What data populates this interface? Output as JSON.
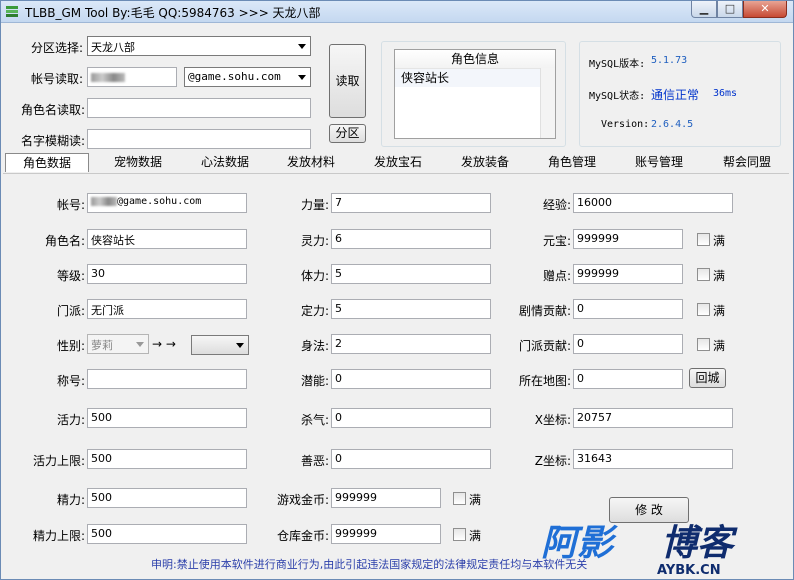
{
  "window": {
    "title": "TLBB_GM Tool By:毛毛 QQ:5984763 >>> 天龙八部"
  },
  "top": {
    "server_label": "分区选择:",
    "server_value": "天龙八部",
    "account_label": "帐号读取:",
    "account_domain": "@game.sohu.com",
    "role_read_label": "角色名读取:",
    "fuzzy_label": "名字模糊读:",
    "read_button": "读取",
    "partition_button": "分区"
  },
  "role_info": {
    "header": "角色信息",
    "items": [
      "侠容站长"
    ]
  },
  "mysql": {
    "version_label": "MySQL版本:",
    "version_value": "5.1.73",
    "status_label": "MySQL状态:",
    "status_value": "通信正常",
    "latency": "36ms",
    "tool_version_label": "Version:",
    "tool_version_value": "2.6.4.5"
  },
  "tabs": [
    "角色数据",
    "宠物数据",
    "心法数据",
    "发放材料",
    "发放宝石",
    "发放装备",
    "角色管理",
    "账号管理",
    "帮会同盟"
  ],
  "form": {
    "account_label": "帐号:",
    "account_suffix": "@game.sohu.com",
    "role_name_label": "角色名:",
    "role_name": "侠容站长",
    "level_label": "等级:",
    "level": "30",
    "sect_label": "门派:",
    "sect": "无门派",
    "gender_label": "性别:",
    "gender": "萝莉",
    "arrow": "→ →",
    "title_label": "称号:",
    "title": "",
    "vitality_label": "活力:",
    "vitality": "500",
    "vitality_max_label": "活力上限:",
    "vitality_max": "500",
    "energy_label": "精力:",
    "energy": "500",
    "energy_max_label": "精力上限:",
    "energy_max": "500",
    "str_label": "力量:",
    "str": "7",
    "spirit_label": "灵力:",
    "spirit": "6",
    "con_label": "体力:",
    "con": "5",
    "focus_label": "定力:",
    "focus": "5",
    "agi_label": "身法:",
    "agi": "2",
    "potential_label": "潜能:",
    "potential": "0",
    "killing_label": "杀气:",
    "killing": "0",
    "goodness_label": "善恶:",
    "goodness": "0",
    "game_gold_label": "游戏金币:",
    "game_gold": "999999",
    "bank_gold_label": "仓库金币:",
    "bank_gold": "999999",
    "exp_label": "经验:",
    "exp": "16000",
    "yuanbao_label": "元宝:",
    "yuanbao": "999999",
    "bonus_label": "赠点:",
    "bonus": "999999",
    "plot_label": "剧情贡献:",
    "plot": "0",
    "sect_contrib_label": "门派贡献:",
    "sect_contrib": "0",
    "map_label": "所在地图:",
    "map": "0",
    "return_button": "回城",
    "x_label": "X坐标:",
    "x": "20757",
    "z_label": "Z坐标:",
    "z": "31643",
    "full_label": "满",
    "modify_button": "修 改"
  },
  "footer": "申明:禁止使用本软件进行商业行为,由此引起违法国家规定的法律规定责任均与本软件无关",
  "watermark": {
    "text": "阿影博客",
    "sub": "AYBK.CN"
  },
  "colors": {
    "accent_blue": "#1f5fbf",
    "status_blue": "#0033cc"
  }
}
